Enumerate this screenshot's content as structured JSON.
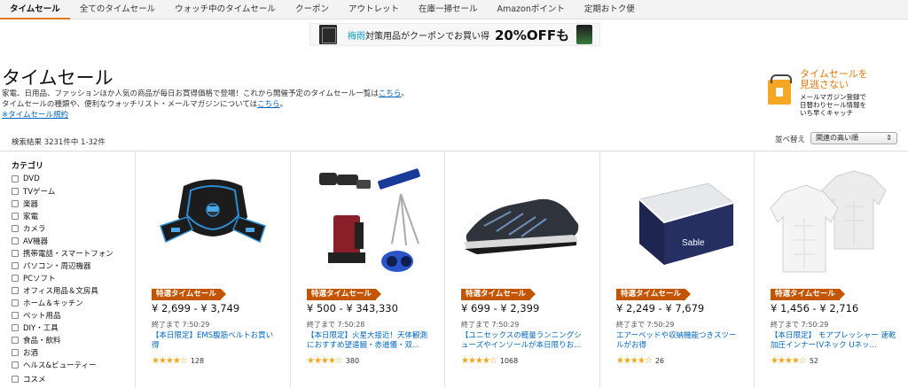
{
  "nav": {
    "items": [
      "タイムセール",
      "全てのタイムセール",
      "ウォッチ中のタイムセール",
      "クーポン",
      "アウトレット",
      "在庫一掃セール",
      "Amazonポイント",
      "定期おトク便"
    ]
  },
  "banner": {
    "text_highlight": "梅雨",
    "text_rest": "対策用品がクーポンでお買い得",
    "percent": "20%OFFも"
  },
  "header": {
    "title": "タイムセール",
    "desc1_text": "家電、日用品、ファッションほか人気の商品が毎日お買得価格で登場！これから開催予定のタイムセール一覧は",
    "desc1_link": "こちら",
    "desc1_end": "。",
    "desc2_text": "タイムセールの種類や、便利なウォッチリスト・メールマガジンについては",
    "desc2_link": "こちら",
    "desc2_end": "。",
    "terms_link": "※タイムセール規約"
  },
  "promo": {
    "title_line1": "タイムセールを",
    "title_line2": "見逃さない",
    "sub_line1": "メールマガジン登録で",
    "sub_line2": "日替わりセール情報を",
    "sub_line3": "いち早くキャッチ"
  },
  "results": {
    "count_text": "検索結果 3231件中 1-32件",
    "sort_label": "並べ替え",
    "sort_value": "関連の高い順"
  },
  "sidebar": {
    "heading": "カテゴリ",
    "items": [
      "DVD",
      "TVゲーム",
      "楽器",
      "家電",
      "カメラ",
      "AV機器",
      "携帯電話・スマートフォン",
      "パソコン・周辺機器",
      "PCソフト",
      "オフィス用品＆文房具",
      "ホーム＆キッチン",
      "ペット用品",
      "DIY・工具",
      "食品・飲料",
      "お酒",
      "ヘルス&ビューティー",
      "コスメ"
    ]
  },
  "colors": {
    "badge": "#c45500",
    "link": "#0066c0",
    "accent": "#e47911",
    "star": "#f4a41d"
  },
  "products": [
    {
      "image": "ems-belt-image",
      "badge": "特選タイムセール",
      "price": "¥ 2,699 - ¥ 3,749",
      "ends": "終了まで 7:50:29",
      "title": "【本日限定】EMS腹筋ベルトお買い得",
      "rating": 4,
      "stars": "★★★★☆",
      "reviews": "128"
    },
    {
      "image": "telescope-set-image",
      "badge": "特選タイムセール",
      "price": "¥ 500 - ¥ 343,330",
      "ends": "終了まで 7:50:28",
      "title": "【本日限定】火星大接近！天体観測におすすめ望遠鏡・赤道儀・双...",
      "rating": 4,
      "stars": "★★★★☆",
      "reviews": "380"
    },
    {
      "image": "running-shoe-image",
      "badge": "特選タイムセール",
      "price": "¥ 699 - ¥ 2,399",
      "ends": "終了まで 7:50:29",
      "title": "【ユニセックスの軽量ランニングシューズやインソールが本日限りお...",
      "rating": 4,
      "stars": "★★★★☆",
      "reviews": "1068"
    },
    {
      "image": "air-bed-image",
      "badge": "特選タイムセール",
      "price": "¥ 2,249 - ¥ 7,679",
      "ends": "終了まで 7:50:29",
      "title": "エアーベッドや収納機能つきスツールがお得",
      "rating": 4,
      "stars": "★★★★☆",
      "reviews": "26"
    },
    {
      "image": "compression-shirt-image",
      "badge": "特選タイムセール",
      "price": "¥ 1,456 - ¥ 2,716",
      "ends": "終了まで 7:50:29",
      "title": "【本日限定】 モアプレッシャー 速乾加圧インナー(Vネック Uネッ...",
      "rating": 4,
      "stars": "★★★★☆",
      "reviews": "52"
    }
  ]
}
